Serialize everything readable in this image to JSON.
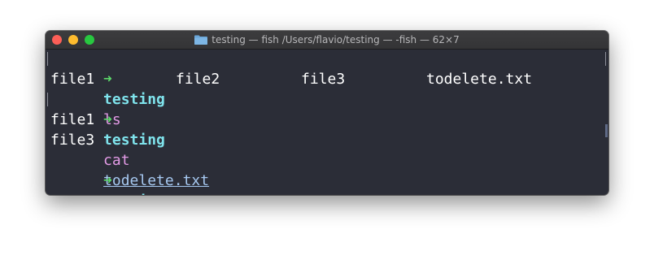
{
  "window": {
    "title": "testing — fish /Users/flavio/testing — -fish — 62×7"
  },
  "terminal": {
    "prompt_arrow": "➜",
    "lines": [
      {
        "dir": "testing",
        "cmd": "ls",
        "arg": ""
      },
      {
        "dir": "testing",
        "cmd": "cat",
        "arg": "todelete.txt"
      },
      {
        "dir": "testing",
        "cmd": "",
        "arg": ""
      }
    ],
    "ls_output": [
      "file1",
      "file2",
      "file3",
      "todelete.txt"
    ],
    "cat_output": [
      "file1",
      "file3"
    ]
  },
  "colors": {
    "background": "#2b2d37",
    "prompt_arrow": "#5cd86a",
    "directory": "#7fe3ec",
    "command": "#e39be6",
    "argument": "#a6c8f0",
    "cursor": "#7fee5c"
  }
}
